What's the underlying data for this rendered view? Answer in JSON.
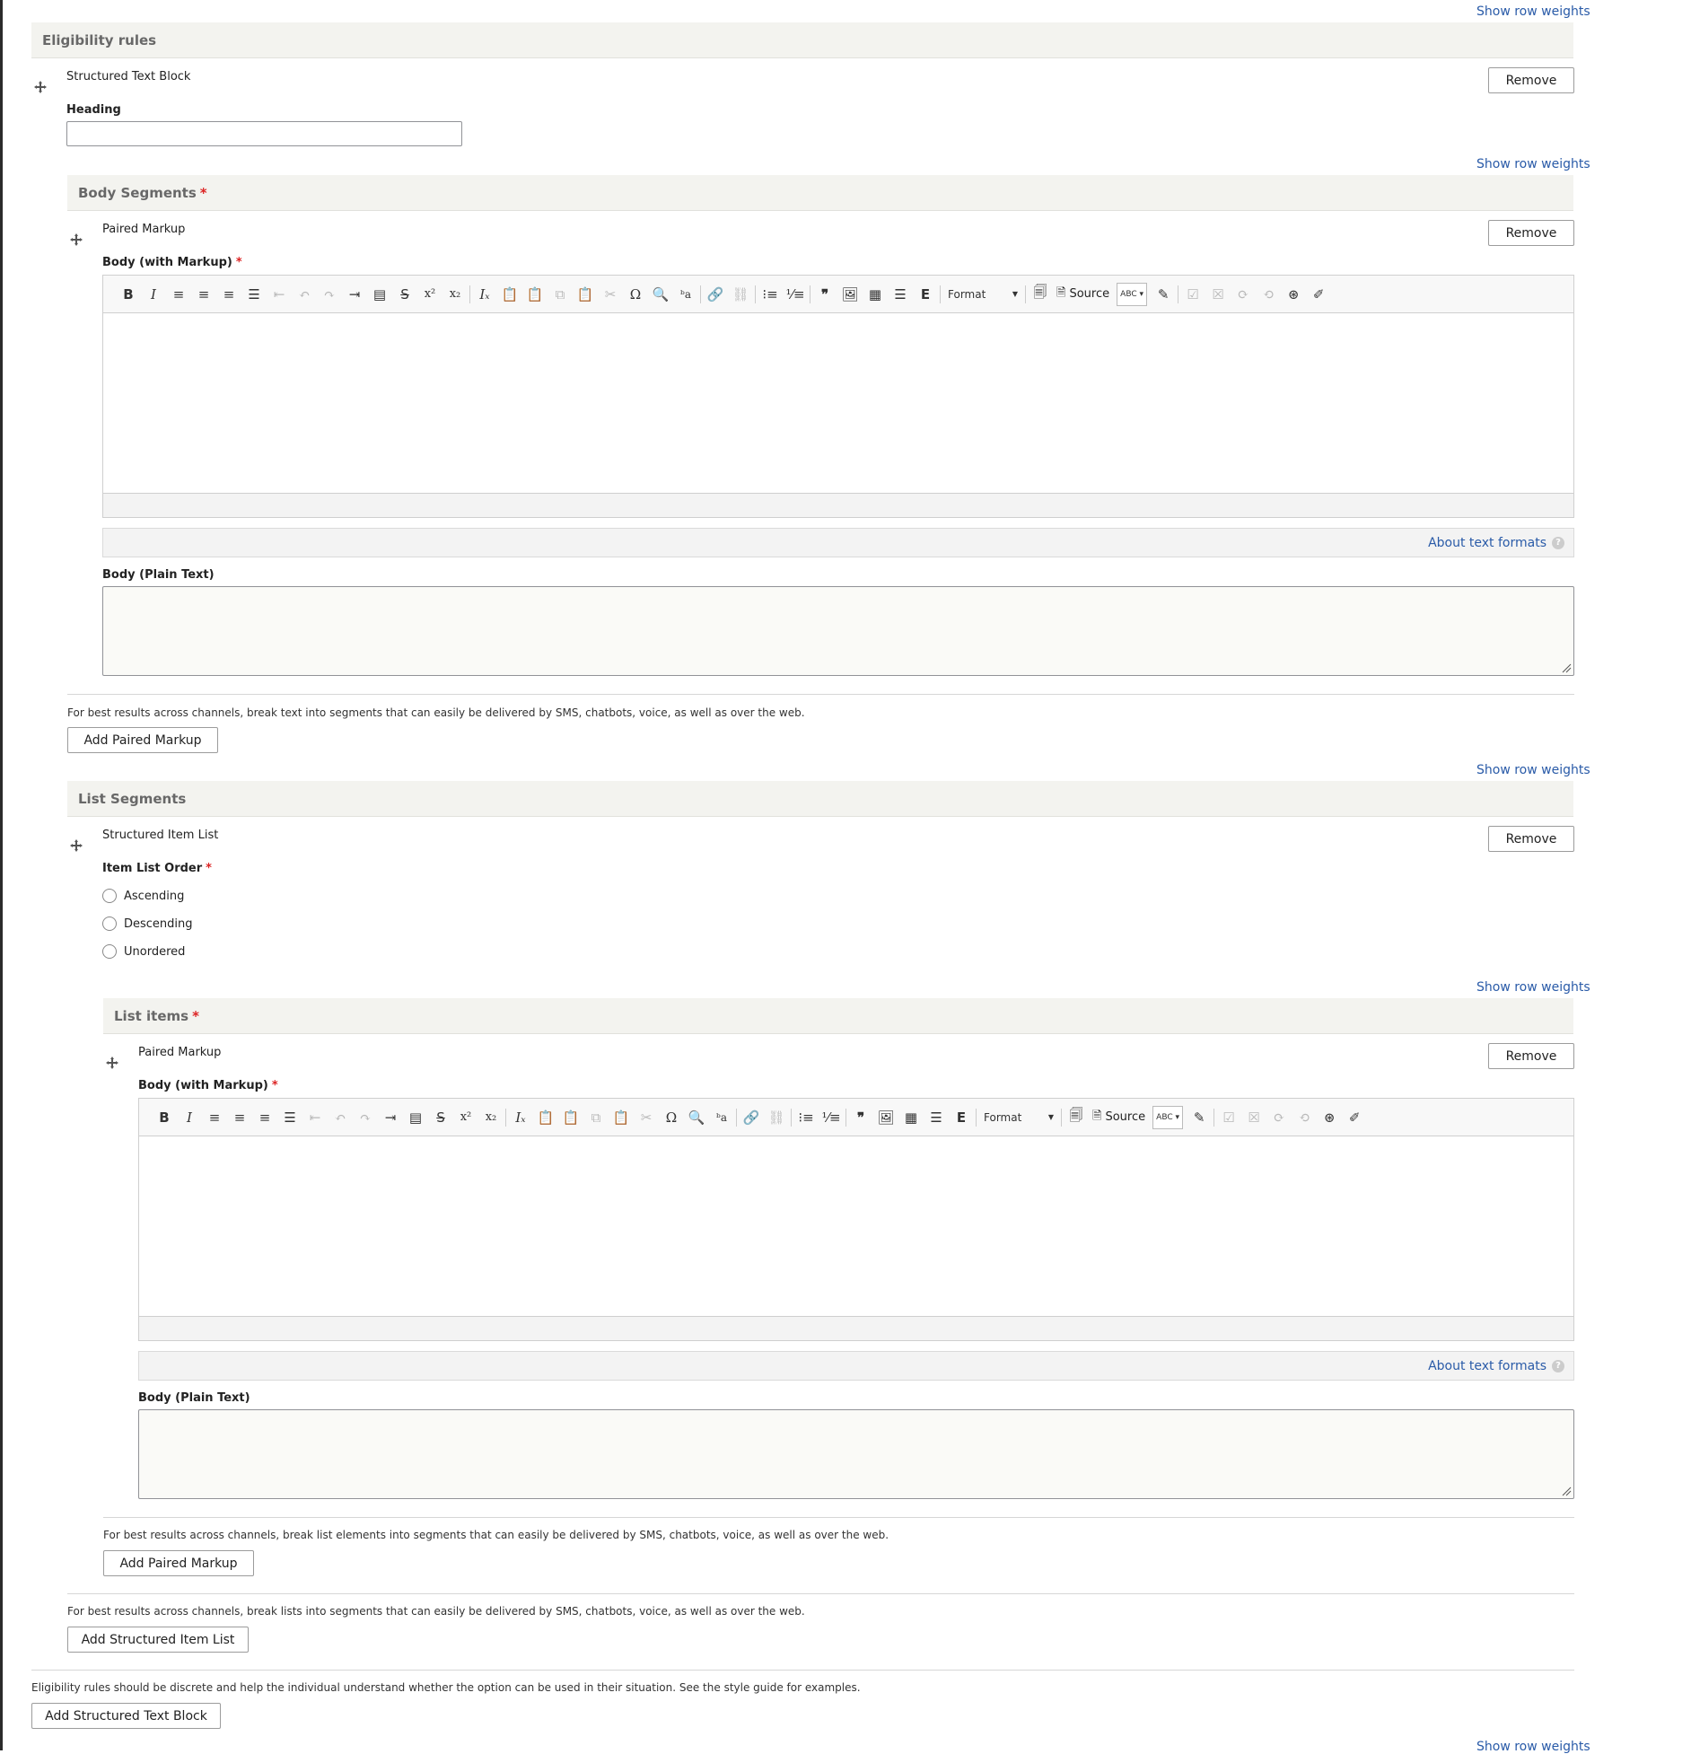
{
  "show_row_weights": "Show row weights",
  "remove_label": "Remove",
  "about_text_formats": "About text formats",
  "eligibility": {
    "title": "Eligibility rules",
    "description": "Eligibility rules should be discrete and help the individual understand whether the option can be used in their situation. See the style guide for examples.",
    "add_button": "Add Structured Text Block"
  },
  "structured_text_block": {
    "row_title": "Structured Text Block",
    "heading_label": "Heading",
    "heading_value": ""
  },
  "body_segments": {
    "title": "Body Segments",
    "required": "*",
    "row_title": "Paired Markup",
    "body_markup_label": "Body (with Markup)",
    "body_plain_label": "Body (Plain Text)",
    "description": "For best results across channels, break text into segments that can easily be delivered by SMS, chatbots, voice, as well as over the web.",
    "add_button": "Add Paired Markup"
  },
  "list_segments": {
    "title": "List Segments",
    "row_title": "Structured Item List",
    "order_label": "Item List Order",
    "required": "*",
    "options": [
      "Ascending",
      "Descending",
      "Unordered"
    ],
    "description": "For best results across channels, break lists into segments that can easily be delivered by SMS, chatbots, voice, as well as over the web.",
    "add_button": "Add Structured Item List"
  },
  "list_items": {
    "title": "List items",
    "required": "*",
    "row_title": "Paired Markup",
    "body_markup_label": "Body (with Markup)",
    "body_plain_label": "Body (Plain Text)",
    "description": "For best results across channels, break list elements into segments that can easily be delivered by SMS, chatbots, voice, as well as over the web.",
    "add_button": "Add Paired Markup"
  },
  "toolbar": {
    "format_label": "Format",
    "source_label": "Source",
    "spell_label": "ABC"
  }
}
